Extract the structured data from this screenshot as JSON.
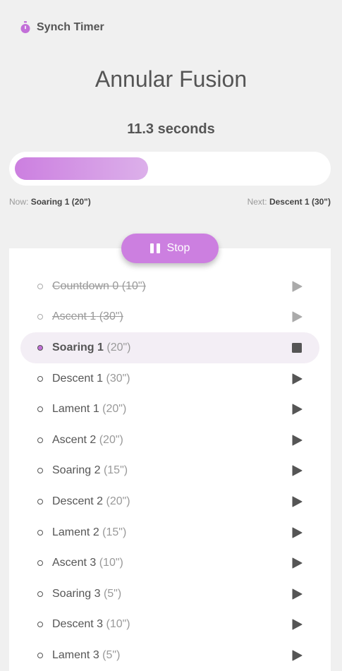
{
  "app": {
    "title": "Synch Timer",
    "icon": "stopwatch-icon",
    "accent": "#cc7fe0"
  },
  "session": {
    "title": "Annular Fusion",
    "elapsed": "11.3 seconds"
  },
  "progress": {
    "fraction": 0.43
  },
  "now": {
    "label": "Now:",
    "value": "Soaring 1  (20\")"
  },
  "next": {
    "label": "Next:",
    "value": "Descent 1  (30\")"
  },
  "controls": {
    "stop_label": "Stop",
    "stop_icon": "pause-icon"
  },
  "tracks": [
    {
      "name": "Countdown 0",
      "duration": "(10\")",
      "state": "done"
    },
    {
      "name": "Ascent 1",
      "duration": "(30\")",
      "state": "done"
    },
    {
      "name": "Soaring 1",
      "duration": "(20\")",
      "state": "active"
    },
    {
      "name": "Descent 1",
      "duration": "(30\")",
      "state": "pending"
    },
    {
      "name": "Lament 1",
      "duration": "(20\")",
      "state": "pending"
    },
    {
      "name": "Ascent 2",
      "duration": "(20\")",
      "state": "pending"
    },
    {
      "name": "Soaring 2",
      "duration": "(15\")",
      "state": "pending"
    },
    {
      "name": "Descent 2",
      "duration": "(20\")",
      "state": "pending"
    },
    {
      "name": "Lament 2",
      "duration": "(15\")",
      "state": "pending"
    },
    {
      "name": "Ascent 3",
      "duration": "(10\")",
      "state": "pending"
    },
    {
      "name": "Soaring 3",
      "duration": "(5\")",
      "state": "pending"
    },
    {
      "name": "Descent 3",
      "duration": "(10\")",
      "state": "pending"
    },
    {
      "name": "Lament 3",
      "duration": "(5\")",
      "state": "pending"
    }
  ]
}
